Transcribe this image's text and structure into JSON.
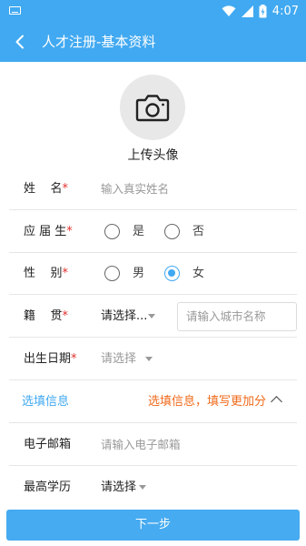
{
  "status_bar": {
    "time": "4:07",
    "icons": [
      "keyboard-icon",
      "wifi-icon",
      "signal-icon",
      "battery-charging-icon"
    ]
  },
  "header": {
    "title": "人才注册-基本资料",
    "back_icon": "chevron-left-icon"
  },
  "avatar": {
    "icon": "camera-icon",
    "label": "上传头像"
  },
  "form": {
    "name": {
      "label": "姓    名",
      "required": "*",
      "placeholder": "输入真实姓名"
    },
    "graduate": {
      "label": "应 届 生",
      "required": "*",
      "options": [
        "是",
        "否"
      ],
      "selected": null
    },
    "gender": {
      "label": "性    别",
      "required": "*",
      "options": [
        "男",
        "女"
      ],
      "selected": "女"
    },
    "hometown": {
      "label": "籍    贯",
      "required": "*",
      "select_value": "请选择...",
      "city_placeholder": "请输入城市名称"
    },
    "birthdate": {
      "label": "出生日期",
      "required": "*",
      "select_value": "请选择"
    }
  },
  "optional_section": {
    "title": "选填信息",
    "hint": "选填信息，填写更加分",
    "toggle_icon": "chevron-up-icon"
  },
  "optional": {
    "email": {
      "label": "电子邮箱",
      "placeholder": "请输入电子邮箱"
    },
    "education": {
      "label": "最高学历",
      "select_value": "请选择"
    }
  },
  "footer": {
    "next_label": "下一步"
  },
  "colors": {
    "primary": "#41a9f1",
    "required": "#e0302d",
    "accent_orange": "#f06a1a"
  }
}
